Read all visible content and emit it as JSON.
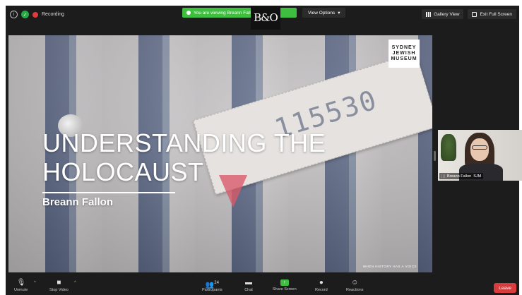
{
  "topbar": {
    "recording_label": "Recording",
    "viewing_banner": "You are viewing Breann Fallon's screen",
    "view_options_label": "View Options",
    "brand_mark": "B&O",
    "gallery_view_label": "Gallery View",
    "exit_full_screen_label": "Exit Full Screen"
  },
  "slide": {
    "logo_lines": [
      "SYDNEY",
      "JEWISH",
      "MUSEUM"
    ],
    "title_line1": "UNDERSTANDING THE",
    "title_line2": "HOLOCAUST",
    "presenter": "Breann Fallon",
    "tag_number": "115530",
    "footer": "WHEN HISTORY HAS A VOICE"
  },
  "participant": {
    "name": "Breann Fallon",
    "org": "SJM"
  },
  "toolbar": {
    "unmute_label": "Unmute",
    "stop_video_label": "Stop Video",
    "participants_label": "Participants",
    "participants_count": "24",
    "chat_label": "Chat",
    "share_screen_label": "Share Screen",
    "record_label": "Record",
    "reactions_label": "Reactions",
    "leave_label": "Leave"
  },
  "colors": {
    "accent_green": "#3fbf3f",
    "leave_red": "#d93c3c",
    "background": "#1c1c1c"
  }
}
